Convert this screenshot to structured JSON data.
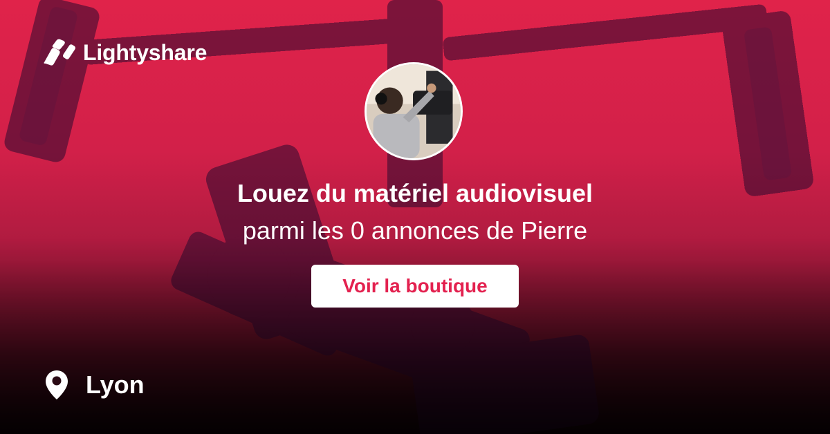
{
  "brand": {
    "name": "Lightyshare",
    "logo_icon": "lightyshare-logo-icon"
  },
  "profile": {
    "avatar_icon": "avatar-photo"
  },
  "hero": {
    "headline": "Louez du matériel audiovisuel",
    "subline": "parmi les 0 annonces de Pierre"
  },
  "cta": {
    "label": "Voir la boutique"
  },
  "location": {
    "icon": "map-pin-icon",
    "city": "Lyon"
  },
  "colors": {
    "brand_red": "#e3214f",
    "text": "#ffffff",
    "button_bg": "#ffffff"
  }
}
